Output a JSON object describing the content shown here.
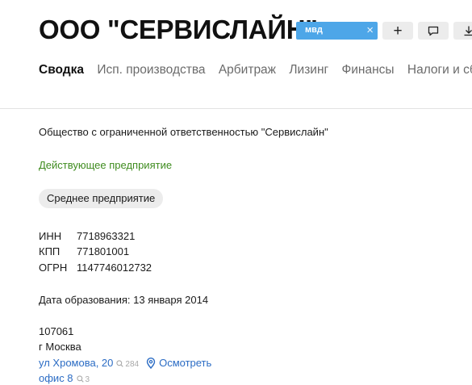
{
  "header": {
    "title": "ООО \"СЕРВИСЛАЙН\"",
    "tag": {
      "label": "мвд"
    },
    "toolbar": {
      "add_glyph": "+"
    }
  },
  "tabs": [
    {
      "label": "Сводка",
      "active": true
    },
    {
      "label": "Исп. производства",
      "active": false
    },
    {
      "label": "Арбитраж",
      "active": false
    },
    {
      "label": "Лизинг",
      "active": false
    },
    {
      "label": "Финансы",
      "active": false
    },
    {
      "label": "Налоги и сб",
      "active": false
    }
  ],
  "company": {
    "full_name": "Общество с ограниченной ответственностью \"Сервислайн\"",
    "status": "Действующее предприятие",
    "size_badge": "Среднее предприятие",
    "ids": [
      {
        "label": "ИНН",
        "value": "7718963321"
      },
      {
        "label": "КПП",
        "value": "771801001"
      },
      {
        "label": "ОГРН",
        "value": "1147746012732"
      }
    ],
    "registration": "Дата образования: 13 января 2014",
    "address": {
      "postcode": "107061",
      "city": "г Москва",
      "street": "ул Хромова, 20",
      "street_count": "284",
      "view_label": "Осмотреть",
      "office": "офис 8",
      "office_count": "3"
    }
  },
  "colors": {
    "accent_link": "#2b6cc4",
    "status_green": "#3f8c1f",
    "tag_blue": "#4da6e8"
  },
  "icons": [
    "close-icon",
    "plus-icon",
    "comment-icon",
    "download-icon",
    "search-icon",
    "location-pin-icon"
  ]
}
